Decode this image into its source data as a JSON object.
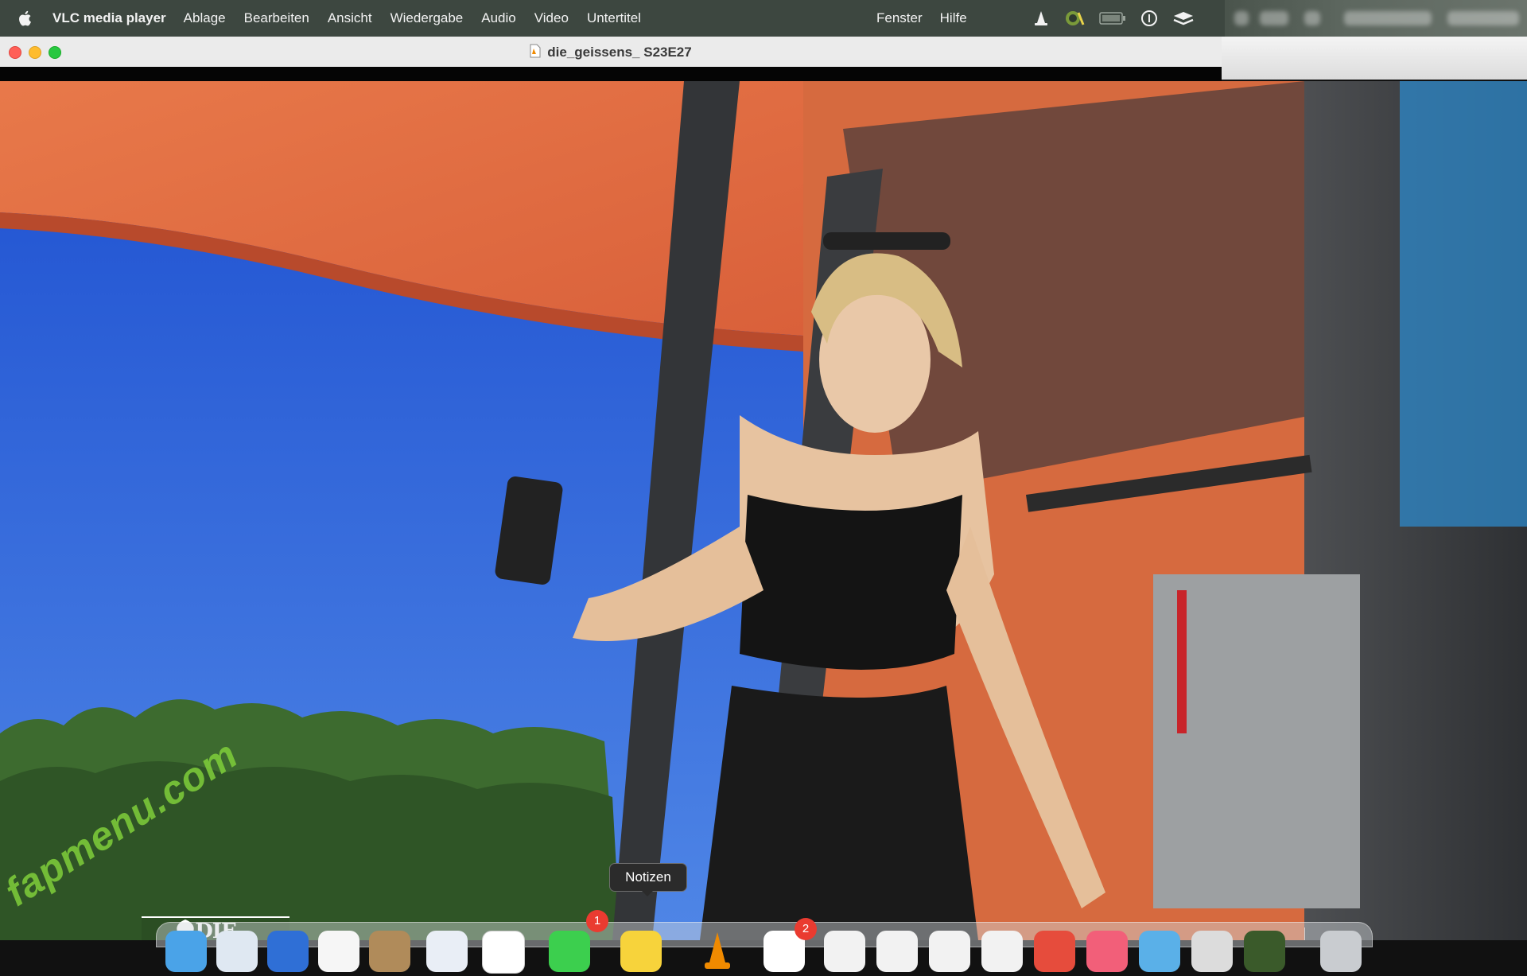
{
  "menubar": {
    "app_name": "VLC media player",
    "items": [
      "Ablage",
      "Bearbeiten",
      "Ansicht",
      "Wiedergabe",
      "Audio",
      "Video",
      "Untertitel"
    ],
    "right_items": [
      "Fenster",
      "Hilfe"
    ],
    "status_icons": [
      "vlc-cone-icon",
      "sync-icon",
      "battery-icon",
      "info-icon",
      "stack-icon"
    ]
  },
  "window": {
    "title": "die_geissens_ S23E27"
  },
  "video": {
    "watermark": "fapmenu.com",
    "logo": "DIE GEISSENS"
  },
  "tooltip": {
    "label": "Notizen"
  },
  "dock": {
    "badges": {
      "messages": "1",
      "calendar": "2"
    },
    "icons": [
      "finder-icon",
      "safari-icon",
      "mail-icon",
      "photos-icon",
      "contacts-icon",
      "chrome-icon",
      "chatgpt-icon",
      "messages-icon",
      "notes-icon",
      "vlc-icon",
      "calendar-icon",
      "app-icon",
      "app-icon",
      "app-icon",
      "app-icon",
      "app-store-icon",
      "music-icon",
      "app-icon",
      "app-icon",
      "app-icon",
      "trash-icon"
    ]
  },
  "colors": {
    "menubar_bg": "#3d4740",
    "traffic_close": "#ff5f57",
    "traffic_min": "#febc2e",
    "traffic_max": "#28c840",
    "watermark": "#7fcf3a",
    "badge": "#ea3b30"
  }
}
